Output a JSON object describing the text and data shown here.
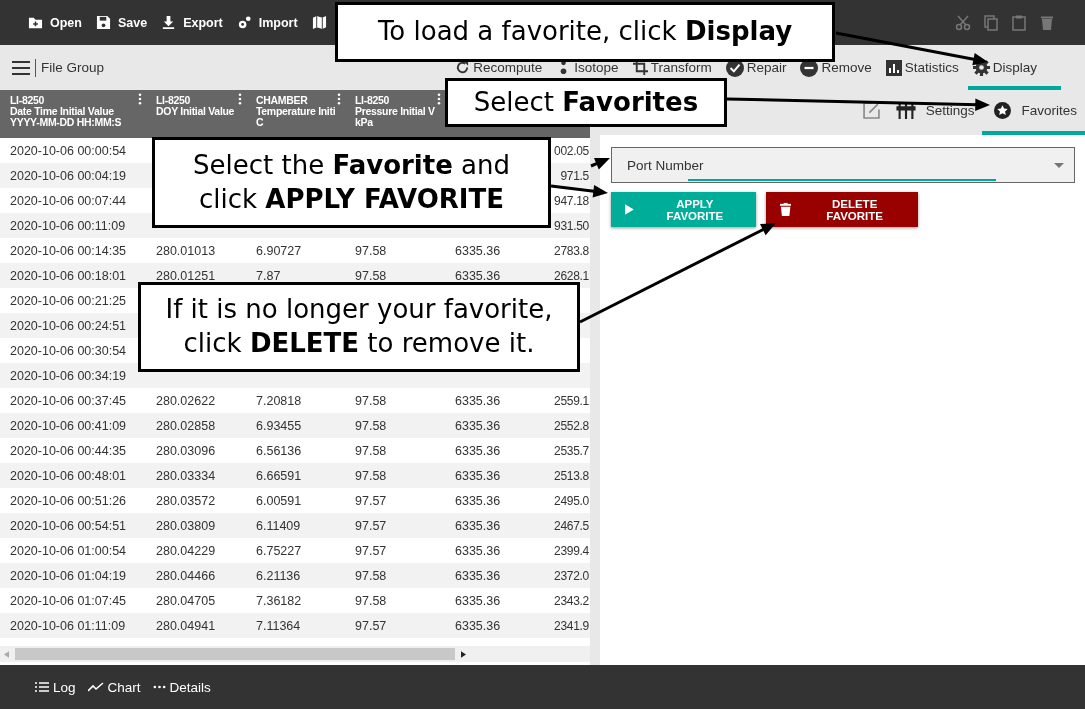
{
  "toolbar": {
    "buttons": [
      {
        "kind": "open",
        "label": "Open"
      },
      {
        "kind": "save",
        "label": "Save"
      },
      {
        "kind": "export",
        "label": "Export"
      },
      {
        "kind": "import",
        "label": "Import"
      },
      {
        "kind": "map"
      }
    ]
  },
  "menu_bar": {
    "title": "File Group",
    "actions": [
      {
        "kind": "recompute",
        "label": "Recompute",
        "selected": false
      },
      {
        "kind": "isotope",
        "label": "Isotope",
        "selected": false
      },
      {
        "kind": "transform",
        "label": "Transform",
        "selected": false
      },
      {
        "kind": "repair",
        "label": "Repair",
        "selected": false
      },
      {
        "kind": "remove",
        "label": "Remove",
        "selected": false
      },
      {
        "kind": "statistics",
        "label": "Statistics",
        "selected": false
      },
      {
        "kind": "display",
        "label": "Display",
        "selected": true
      }
    ]
  },
  "table": {
    "columns": [
      {
        "lines": [
          "LI-8250",
          "Date Time Initial Value",
          "YYYY-MM-DD HH:MM:S"
        ]
      },
      {
        "lines": [
          "LI-8250",
          "DOY Initial Value"
        ]
      },
      {
        "lines": [
          "CHAMBER",
          "Temperature Initi",
          "C"
        ]
      },
      {
        "lines": [
          "LI-8250",
          "Pressure Initial V",
          "kPa"
        ]
      }
    ],
    "rows": [
      {
        "cells": [
          "2020-10-06 00:00:54",
          null,
          null,
          null,
          null,
          "002.05"
        ]
      },
      {
        "cells": [
          "2020-10-06 00:04:19",
          null,
          null,
          null,
          null,
          "971.5"
        ]
      },
      {
        "cells": [
          "2020-10-06 00:07:44",
          null,
          null,
          null,
          null,
          "947.18"
        ]
      },
      {
        "cells": [
          "2020-10-06 00:11:09",
          null,
          null,
          null,
          null,
          "931.50"
        ]
      },
      {
        "cells": [
          "2020-10-06 00:14:35",
          "280.01013",
          "6.90727",
          "97.58",
          "6335.36",
          "2783.8"
        ]
      },
      {
        "cells": [
          "2020-10-06 00:18:01",
          "280.01251",
          "7.87",
          "97.58",
          "6335.36",
          "2628.1"
        ]
      },
      {
        "cells": [
          "2020-10-06 00:21:25",
          null,
          null,
          null,
          null,
          null
        ]
      },
      {
        "cells": [
          "2020-10-06 00:24:51",
          null,
          null,
          null,
          null,
          null
        ]
      },
      {
        "cells": [
          "2020-10-06 00:30:54",
          null,
          null,
          null,
          null,
          null
        ]
      },
      {
        "cells": [
          "2020-10-06 00:34:19",
          null,
          null,
          null,
          null,
          null
        ]
      },
      {
        "cells": [
          "2020-10-06 00:37:45",
          "280.02622",
          "7.20818",
          "97.58",
          "6335.36",
          "2559.1"
        ]
      },
      {
        "cells": [
          "2020-10-06 00:41:09",
          "280.02858",
          "6.93455",
          "97.58",
          "6335.36",
          "2552.8"
        ]
      },
      {
        "cells": [
          "2020-10-06 00:44:35",
          "280.03096",
          "6.56136",
          "97.58",
          "6335.36",
          "2535.7"
        ]
      },
      {
        "cells": [
          "2020-10-06 00:48:01",
          "280.03334",
          "6.66591",
          "97.58",
          "6335.36",
          "2513.8"
        ]
      },
      {
        "cells": [
          "2020-10-06 00:51:26",
          "280.03572",
          "6.00591",
          "97.57",
          "6335.36",
          "2495.0"
        ]
      },
      {
        "cells": [
          "2020-10-06 00:54:51",
          "280.03809",
          "6.11409",
          "97.57",
          "6335.36",
          "2467.5"
        ]
      },
      {
        "cells": [
          "2020-10-06 01:00:54",
          "280.04229",
          "6.75227",
          "97.57",
          "6335.36",
          "2399.4"
        ]
      },
      {
        "cells": [
          "2020-10-06 01:04:19",
          "280.04466",
          "6.21136",
          "97.58",
          "6335.36",
          "2372.0"
        ]
      },
      {
        "cells": [
          "2020-10-06 01:07:45",
          "280.04705",
          "7.36182",
          "97.58",
          "6335.36",
          "2343.2"
        ]
      },
      {
        "cells": [
          "2020-10-06 01:11:09",
          "280.04941",
          "7.11364",
          "97.57",
          "6335.36",
          "2341.9"
        ]
      }
    ]
  },
  "panel_tabs": [
    {
      "kind": "edit",
      "selected": false
    },
    {
      "kind": "settings",
      "label": "Settings",
      "selected": false
    },
    {
      "kind": "favorites",
      "label": "Favorites",
      "selected": true
    }
  ],
  "favorites": {
    "dropdown": {
      "value": "Port Number"
    },
    "buttons": [
      {
        "kind": "apply",
        "label": "APPLY FAVORITE"
      },
      {
        "kind": "delete",
        "label": "DELETE FAVORITE"
      }
    ]
  },
  "bottom_bar": [
    {
      "kind": "log",
      "label": "Log"
    },
    {
      "kind": "chart",
      "label": "Chart"
    },
    {
      "kind": "details",
      "label": "Details"
    }
  ],
  "callouts": [
    {
      "lines": [
        "To load a favorite, click **Display**"
      ]
    },
    {
      "lines": [
        "Select **Favorites**"
      ]
    },
    {
      "lines": [
        "Select the **Favorite** and",
        "click **APPLY FAVORITE**"
      ]
    },
    {
      "lines": [
        "If it is no longer your favorite,",
        "click **DELETE** to remove it."
      ]
    }
  ]
}
